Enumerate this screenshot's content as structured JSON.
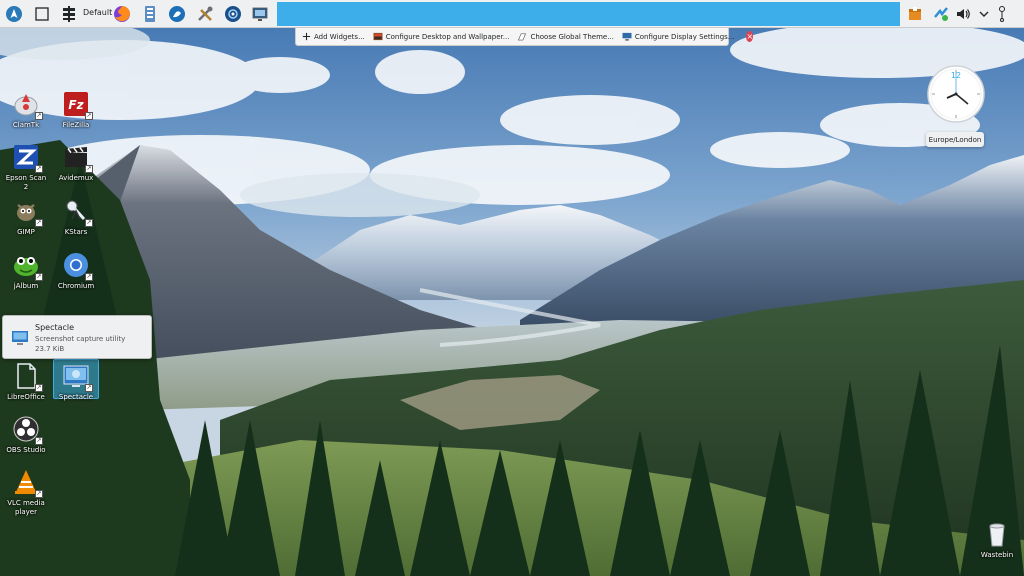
{
  "panel": {
    "activity_label": "Default",
    "tasks_bar_color": "#3daee9",
    "launchers": [
      {
        "name": "application-launcher-icon"
      },
      {
        "name": "show-desktop-icon"
      },
      {
        "name": "activity-switcher-icon"
      },
      {
        "name": "firefox-icon"
      },
      {
        "name": "file-manager-icon"
      },
      {
        "name": "discover-icon"
      },
      {
        "name": "system-settings-icon"
      },
      {
        "name": "plasma-icon"
      },
      {
        "name": "monitor-icon"
      }
    ],
    "tray": [
      "package-icon",
      "network-icon",
      "volume-icon",
      "chevron-down-icon",
      "clock-tray-icon"
    ]
  },
  "toolbox": {
    "items": [
      {
        "label": "Add Widgets..."
      },
      {
        "label": "Configure Desktop and Wallpaper..."
      },
      {
        "label": "Choose Global Theme..."
      },
      {
        "label": "Configure Display Settings..."
      }
    ],
    "close_symbol": "×"
  },
  "desktop_icons": [
    {
      "label": "ClamTk"
    },
    {
      "label": "FileZilla"
    },
    {
      "label": "Epson Scan 2"
    },
    {
      "label": "Avidemux"
    },
    {
      "label": "GIMP"
    },
    {
      "label": "KStars"
    },
    {
      "label": "jAlbum"
    },
    {
      "label": "Chromium"
    },
    {
      "label": "LibreOffice"
    },
    {
      "label": "Spectacle"
    },
    {
      "label": "OBS Studio"
    },
    {
      "label": "VLC media player"
    },
    {
      "label": "Wastebin"
    }
  ],
  "tooltip": {
    "title": "Spectacle",
    "description": "Screenshot capture utility",
    "size": "23.7 KiB"
  },
  "clock": {
    "timezone": "Europe/London",
    "numeral": "12"
  },
  "colors": {
    "accent": "#3daee9",
    "panel_bg": "#eff0f1",
    "close_red": "#da4453"
  }
}
